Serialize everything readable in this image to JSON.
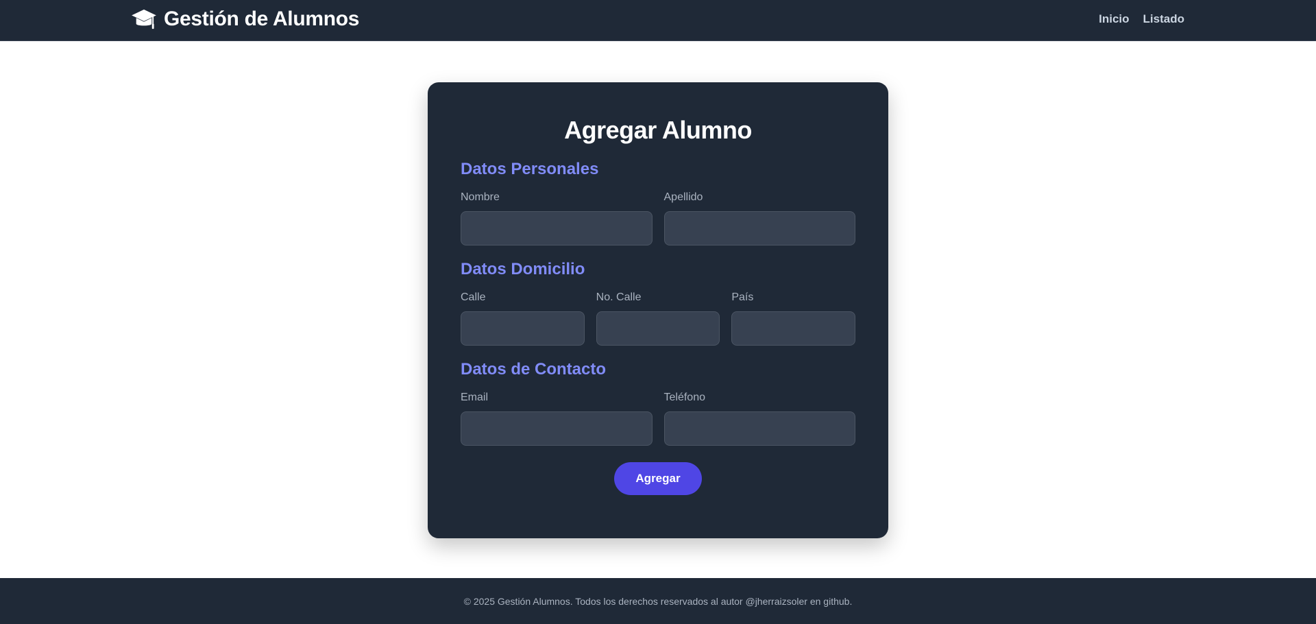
{
  "header": {
    "brand_icon": "graduation-cap-icon",
    "title": "Gestión de Alumnos",
    "nav": [
      {
        "label": "Inicio"
      },
      {
        "label": "Listado"
      }
    ]
  },
  "form": {
    "title": "Agregar Alumno",
    "sections": {
      "personal": {
        "title": "Datos Personales",
        "fields": {
          "nombre": {
            "label": "Nombre",
            "value": ""
          },
          "apellido": {
            "label": "Apellido",
            "value": ""
          }
        }
      },
      "domicilio": {
        "title": "Datos Domicilio",
        "fields": {
          "calle": {
            "label": "Calle",
            "value": ""
          },
          "no_calle": {
            "label": "No. Calle",
            "value": ""
          },
          "pais": {
            "label": "País",
            "value": ""
          }
        }
      },
      "contacto": {
        "title": "Datos de Contacto",
        "fields": {
          "email": {
            "label": "Email",
            "value": ""
          },
          "telefono": {
            "label": "Teléfono",
            "value": ""
          }
        }
      }
    },
    "submit_label": "Agregar"
  },
  "footer": {
    "text": "© 2025 Gestión Alumnos. Todos los derechos reservados al autor @jherraizsoler en github."
  },
  "colors": {
    "navbar_bg": "#1f2937",
    "card_bg": "#1f2937",
    "input_bg": "#374151",
    "section_title": "#818cf8",
    "accent_button": "#4f46e5"
  }
}
